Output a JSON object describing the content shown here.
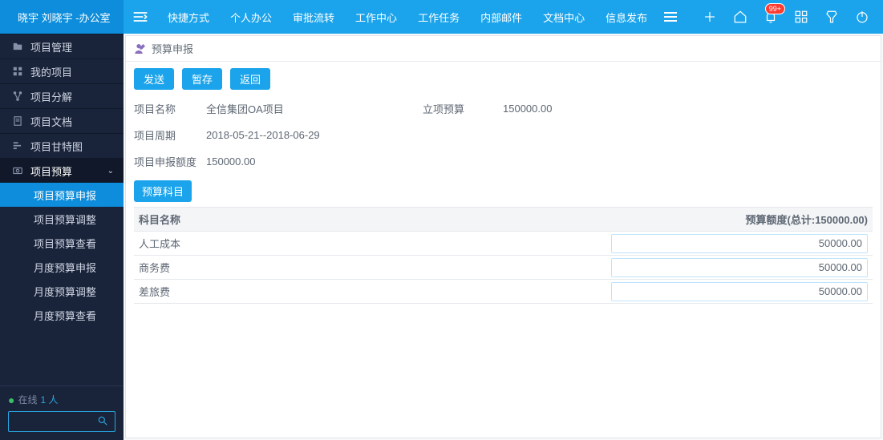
{
  "sidebar": {
    "user": "晓宇  刘晓宇 -办公室",
    "menu": [
      {
        "icon": "folder",
        "label": "项目管理"
      },
      {
        "icon": "grid",
        "label": "我的项目"
      },
      {
        "icon": "tree",
        "label": "项目分解"
      },
      {
        "icon": "doc",
        "label": "项目文档"
      },
      {
        "icon": "gantt",
        "label": "项目甘特图"
      },
      {
        "icon": "money",
        "label": "项目预算",
        "expandable": true,
        "open": true,
        "children": [
          {
            "label": "项目预算申报",
            "active": true
          },
          {
            "label": "项目预算调整"
          },
          {
            "label": "项目预算查看"
          },
          {
            "label": "月度预算申报"
          },
          {
            "label": "月度预算调整"
          },
          {
            "label": "月度预算查看"
          }
        ]
      }
    ],
    "online_label": "在线",
    "online_count": "1 人"
  },
  "topbar": {
    "items": [
      "快捷方式",
      "个人办公",
      "审批流转",
      "工作中心",
      "工作任务",
      "内部邮件",
      "文档中心",
      "信息发布"
    ],
    "badge": "99+"
  },
  "panel": {
    "title": "预算申报",
    "actions": {
      "send": "发送",
      "save": "暂存",
      "back": "返回"
    },
    "fields": {
      "project_name_label": "项目名称",
      "project_name_value": "全信集团OA项目",
      "budget_label": "立项预算",
      "budget_value": "150000.00",
      "period_label": "项目周期",
      "period_value": "2018-05-21--2018-06-29",
      "declare_amount_label": "项目申报额度",
      "declare_amount_value": "150000.00"
    },
    "section_button": "预算科目",
    "table": {
      "col_name": "科目名称",
      "col_amount": "预算额度(总计:150000.00)",
      "rows": [
        {
          "name": "人工成本",
          "amount": "50000.00"
        },
        {
          "name": "商务费",
          "amount": "50000.00"
        },
        {
          "name": "差旅费",
          "amount": "50000.00"
        }
      ]
    }
  }
}
